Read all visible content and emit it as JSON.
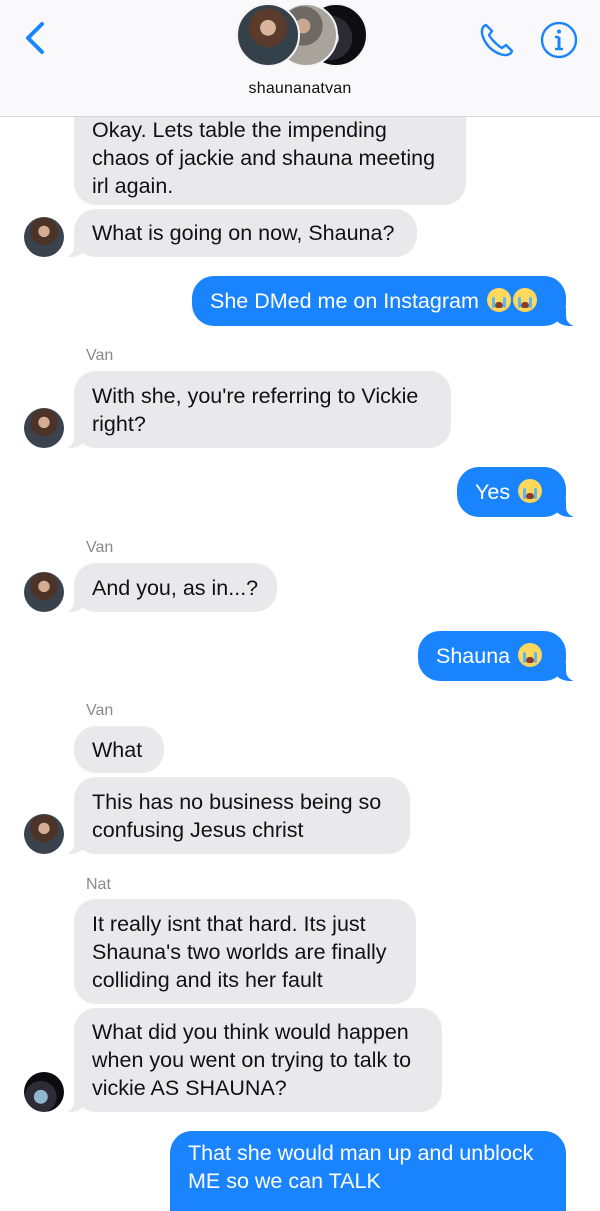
{
  "header": {
    "title": "shaunanatvan",
    "back_icon": "chevron-left-icon",
    "call_icon": "phone-icon",
    "info_icon": "info-icon",
    "accent": "#1a84ff"
  },
  "messages": [
    {
      "side": "in",
      "text": "Okay. Lets table the impending chaos of jackie and shauna meeting irl again."
    },
    {
      "side": "in",
      "text": "What is going on now, Shauna?"
    },
    {
      "side": "out",
      "text": "She DMed me on Instagram",
      "emoji": [
        "loudly-crying-face",
        "loudly-crying-face"
      ]
    },
    {
      "side": "in",
      "sender": "Van",
      "text": "With she, you're referring to Vickie right?"
    },
    {
      "side": "out",
      "text": "Yes",
      "emoji": [
        "loudly-crying-face"
      ]
    },
    {
      "side": "in",
      "sender": "Van",
      "text": "And you, as in...?"
    },
    {
      "side": "out",
      "text": "Shauna",
      "emoji": [
        "loudly-crying-face"
      ]
    },
    {
      "side": "in",
      "sender": "Van",
      "text": "What"
    },
    {
      "side": "in",
      "text": "This has no business being so confusing Jesus christ"
    },
    {
      "side": "in",
      "sender": "Nat",
      "text": "It really isnt that hard. Its just Shauna's two worlds are finally colliding and its her fault"
    },
    {
      "side": "in",
      "text": "What did you think would happen when you went on trying to talk to vickie AS SHAUNA?"
    },
    {
      "side": "out",
      "text": "That she would man up and unblock ME so we can TALK"
    }
  ],
  "colors": {
    "incoming_bubble": "#e9e9eb",
    "outgoing_bubble": "#1a84ff",
    "sender_label": "#8a8a8f"
  }
}
